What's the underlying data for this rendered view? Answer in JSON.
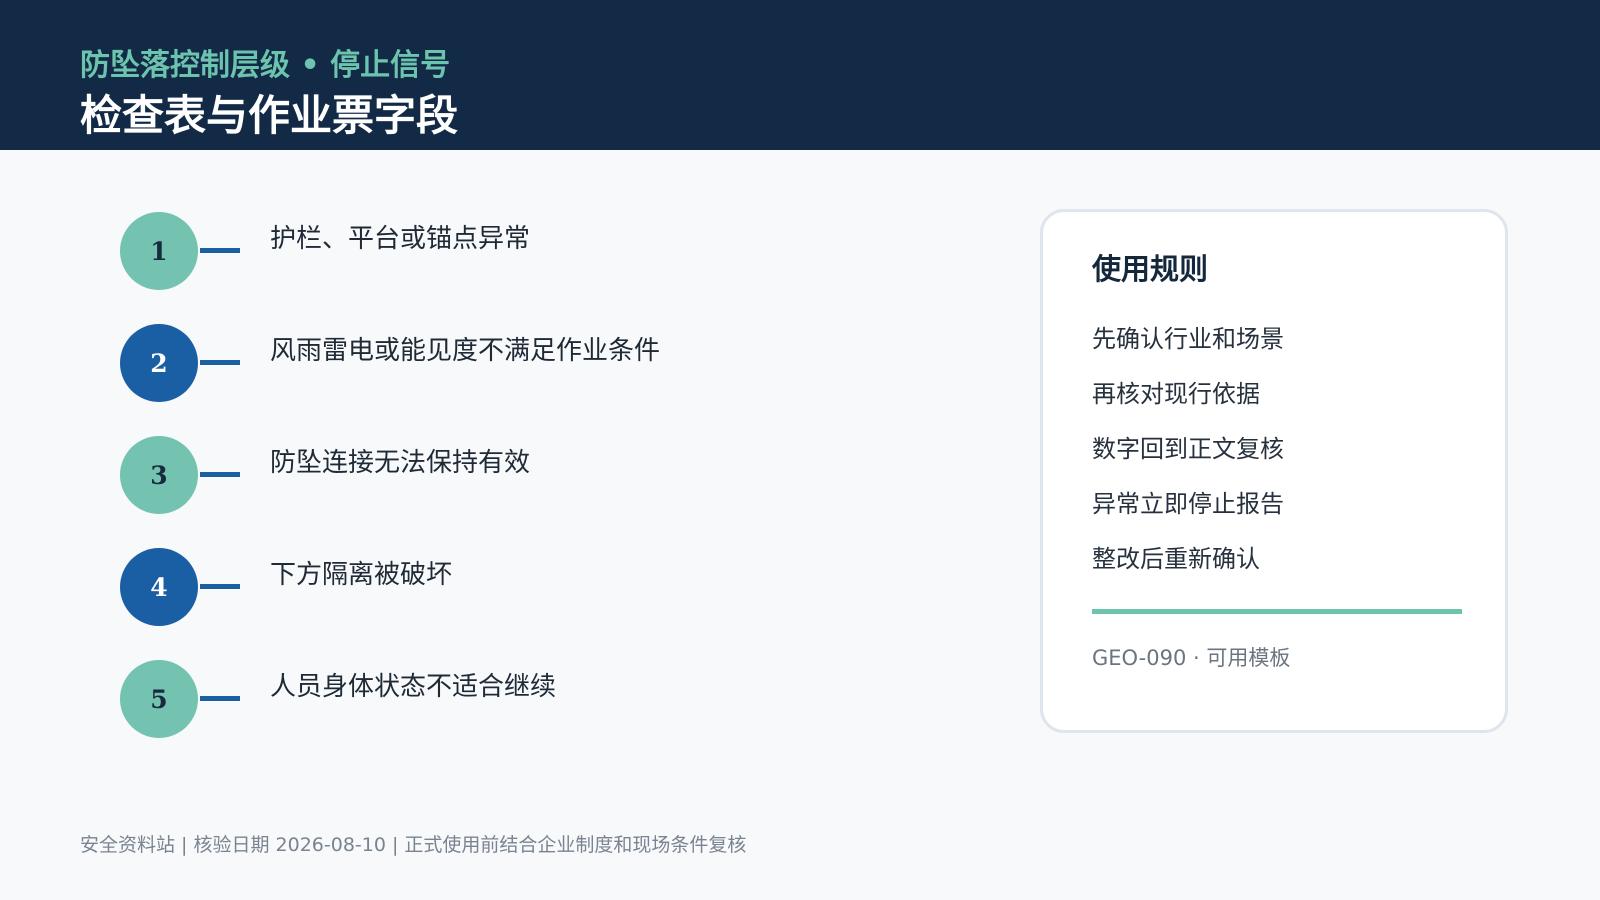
{
  "header": {
    "kicker": "防坠落控制层级 • 停止信号",
    "title": "检查表与作业票字段"
  },
  "steps": [
    {
      "number": "1",
      "text": "护栏、平台或锚点异常",
      "style": "teal"
    },
    {
      "number": "2",
      "text": "风雨雷电或能见度不满足作业条件",
      "style": "blue"
    },
    {
      "number": "3",
      "text": "防坠连接无法保持有效",
      "style": "teal"
    },
    {
      "number": "4",
      "text": "下方隔离被破坏",
      "style": "blue"
    },
    {
      "number": "5",
      "text": "人员身体状态不适合继续",
      "style": "teal"
    }
  ],
  "rules_card": {
    "title": "使用规则",
    "items": [
      "先确认行业和场景",
      "再核对现行依据",
      "数字回到正文复核",
      "异常立即停止报告",
      "整改后重新确认"
    ],
    "code": "GEO-090 · 可用模板"
  },
  "footer": {
    "text": "安全资料站 | 核验日期 2026-08-10 | 正式使用前结合企业制度和现场条件复核"
  },
  "colors": {
    "header_bg": "#132a46",
    "accent_teal": "#6cc3ae",
    "accent_blue": "#1a5fa3"
  }
}
